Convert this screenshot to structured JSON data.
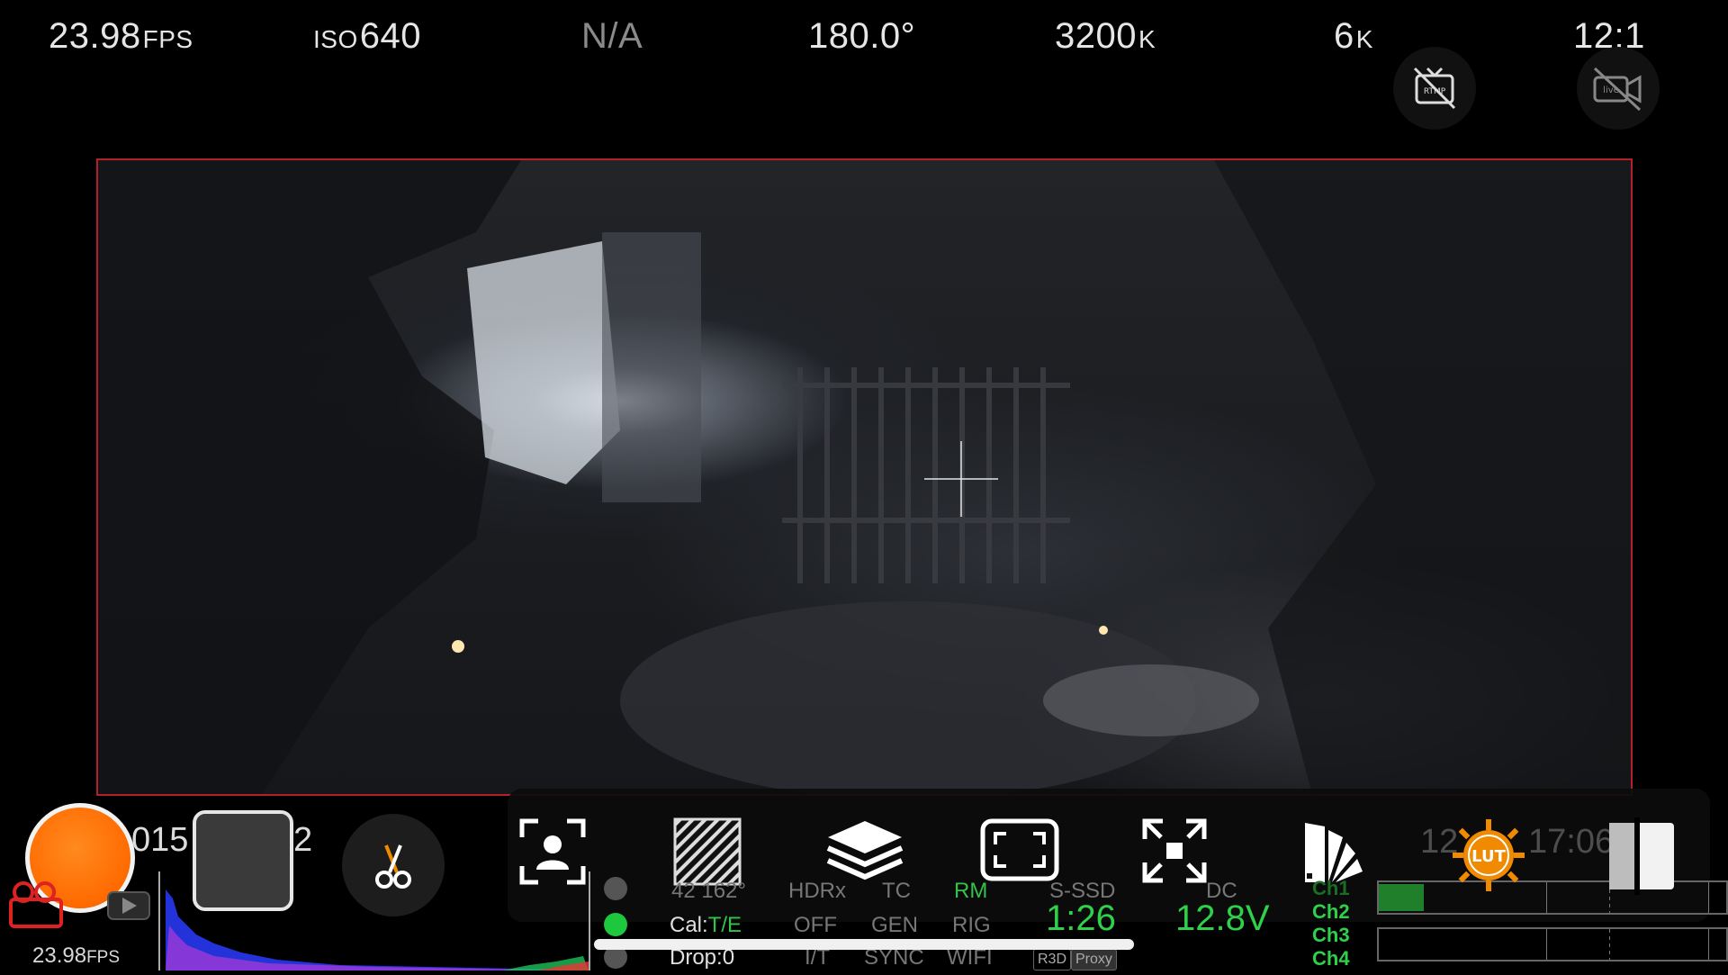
{
  "top_bar": {
    "fps_value": "23.98",
    "fps_unit": "FPS",
    "iso_prefix": "ISO",
    "iso_value": "640",
    "na": "N/A",
    "shutter": "180.0°",
    "white_balance_value": "3200",
    "white_balance_unit": "K",
    "resolution_value": "6",
    "resolution_unit": "K",
    "compression": "12:1",
    "rtmp_icon": "rtmp-off-icon",
    "live_icon": "live-off-icon"
  },
  "bottom": {
    "timecode_left": "015",
    "timecode_right": "2",
    "fps_value": "23.98",
    "fps_unit": "FPS",
    "clock_left": "12",
    "clock_right": "17:06"
  },
  "status": {
    "row1": [
      "42 162°",
      "HDRx",
      "TC",
      "RM",
      "S-SSD",
      "DC"
    ],
    "cal_label": "Cal:",
    "cal_value": "T/E",
    "off": "OFF",
    "gen": "GEN",
    "rig": "RIG",
    "drop": "Drop:0",
    "row3": [
      "I/T",
      "SYNC",
      "WIFI"
    ],
    "badge_r3d": "R3D",
    "badge_proxy": "Proxy",
    "media_remaining": "1:26",
    "voltage": "12.8V",
    "channels": [
      "Ch1",
      "Ch2",
      "Ch3",
      "Ch4"
    ]
  },
  "audio": {
    "meter1_level": 0.13,
    "meter2_level": 0.0
  },
  "colors": {
    "record": "#ff6a00",
    "accent_green": "#2fd04a",
    "frame_red": "#b3202a",
    "lut_orange": "#f08a00"
  }
}
